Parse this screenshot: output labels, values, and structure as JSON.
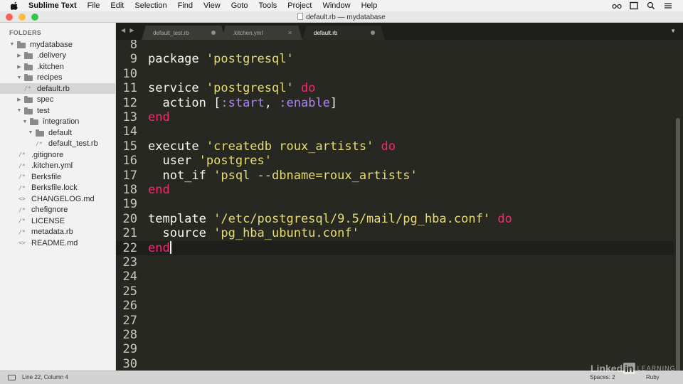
{
  "menubar": {
    "apple_icon": "apple-logo",
    "app_name": "Sublime Text",
    "items": [
      "File",
      "Edit",
      "Selection",
      "Find",
      "View",
      "Goto",
      "Tools",
      "Project",
      "Window",
      "Help"
    ],
    "right_icons": [
      "glasses-icon",
      "window-icon",
      "search-icon",
      "list-icon"
    ]
  },
  "window": {
    "title": "default.rb — mydatabase"
  },
  "sidebar": {
    "heading": "FOLDERS",
    "tree": [
      {
        "label": "mydatabase",
        "kind": "folder",
        "depth": 0,
        "expanded": true
      },
      {
        "label": ".delivery",
        "kind": "folder",
        "depth": 1,
        "expanded": false
      },
      {
        "label": ".kitchen",
        "kind": "folder",
        "depth": 1,
        "expanded": false
      },
      {
        "label": "recipes",
        "kind": "folder",
        "depth": 1,
        "expanded": true
      },
      {
        "label": "default.rb",
        "kind": "file",
        "glyph": "/*",
        "depth": 2,
        "selected": true
      },
      {
        "label": "spec",
        "kind": "folder",
        "depth": 1,
        "expanded": false
      },
      {
        "label": "test",
        "kind": "folder",
        "depth": 1,
        "expanded": true
      },
      {
        "label": "integration",
        "kind": "folder",
        "depth": 2,
        "expanded": true
      },
      {
        "label": "default",
        "kind": "folder",
        "depth": 3,
        "expanded": true
      },
      {
        "label": "default_test.rb",
        "kind": "file",
        "glyph": "/*",
        "depth": 4
      },
      {
        "label": ".gitignore",
        "kind": "file",
        "glyph": "/*",
        "depth": 1
      },
      {
        "label": ".kitchen.yml",
        "kind": "file",
        "glyph": "/*",
        "depth": 1
      },
      {
        "label": "Berksfile",
        "kind": "file",
        "glyph": "/*",
        "depth": 1
      },
      {
        "label": "Berksfile.lock",
        "kind": "file",
        "glyph": "/*",
        "depth": 1
      },
      {
        "label": "CHANGELOG.md",
        "kind": "file",
        "glyph": "<>",
        "depth": 1
      },
      {
        "label": "chefignore",
        "kind": "file",
        "glyph": "/*",
        "depth": 1
      },
      {
        "label": "LICENSE",
        "kind": "file",
        "glyph": "/*",
        "depth": 1
      },
      {
        "label": "metadata.rb",
        "kind": "file",
        "glyph": "/*",
        "depth": 1
      },
      {
        "label": "README.md",
        "kind": "file",
        "glyph": "<>",
        "depth": 1
      }
    ]
  },
  "tabs": [
    {
      "label": "default_test.rb",
      "state": "modified",
      "active": false
    },
    {
      "label": ".kitchen.yml",
      "state": "close",
      "active": false
    },
    {
      "label": "default.rb",
      "state": "modified",
      "active": true
    }
  ],
  "editor": {
    "current_line": 22,
    "lines": [
      {
        "n": "8",
        "tokens": []
      },
      {
        "n": "9",
        "tokens": [
          [
            "plain",
            "package "
          ],
          [
            "str",
            "'postgresql'"
          ]
        ]
      },
      {
        "n": "10",
        "tokens": []
      },
      {
        "n": "11",
        "tokens": [
          [
            "plain",
            "service "
          ],
          [
            "str",
            "'postgresql'"
          ],
          [
            "plain",
            " "
          ],
          [
            "kw",
            "do"
          ]
        ]
      },
      {
        "n": "12",
        "tokens": [
          [
            "plain",
            "  action ["
          ],
          [
            "sym",
            ":start"
          ],
          [
            "plain",
            ", "
          ],
          [
            "sym",
            ":enable"
          ],
          [
            "plain",
            "]"
          ]
        ]
      },
      {
        "n": "13",
        "tokens": [
          [
            "kw",
            "end"
          ]
        ]
      },
      {
        "n": "14",
        "tokens": []
      },
      {
        "n": "15",
        "tokens": [
          [
            "plain",
            "execute "
          ],
          [
            "str",
            "'createdb roux_artists'"
          ],
          [
            "plain",
            " "
          ],
          [
            "kw",
            "do"
          ]
        ]
      },
      {
        "n": "16",
        "tokens": [
          [
            "plain",
            "  user "
          ],
          [
            "str",
            "'postgres'"
          ]
        ]
      },
      {
        "n": "17",
        "tokens": [
          [
            "plain",
            "  not_if "
          ],
          [
            "str",
            "'psql --dbname=roux_artists'"
          ]
        ]
      },
      {
        "n": "18",
        "tokens": [
          [
            "kw",
            "end"
          ]
        ]
      },
      {
        "n": "19",
        "tokens": []
      },
      {
        "n": "20",
        "tokens": [
          [
            "plain",
            "template "
          ],
          [
            "str",
            "'/etc/postgresql/9.5/mail/pg_hba.conf'"
          ],
          [
            "plain",
            " "
          ],
          [
            "kw",
            "do"
          ]
        ]
      },
      {
        "n": "21",
        "tokens": [
          [
            "plain",
            "  source "
          ],
          [
            "str",
            "'pg_hba_ubuntu.conf'"
          ]
        ]
      },
      {
        "n": "22",
        "tokens": [
          [
            "kw",
            "end"
          ]
        ],
        "cursor": true
      },
      {
        "n": "23",
        "tokens": []
      },
      {
        "n": "24",
        "tokens": []
      },
      {
        "n": "25",
        "tokens": []
      },
      {
        "n": "26",
        "tokens": []
      },
      {
        "n": "27",
        "tokens": []
      },
      {
        "n": "28",
        "tokens": []
      },
      {
        "n": "29",
        "tokens": []
      },
      {
        "n": "30",
        "tokens": []
      }
    ]
  },
  "statusbar": {
    "position": "Line 22, Column 4",
    "spaces": "Spaces: 2",
    "syntax": "Ruby"
  },
  "watermark": {
    "brand_a": "Linked",
    "brand_b": "in",
    "brand_c": "LEARNING"
  },
  "colors": {
    "editor_bg": "#272822",
    "string": "#e6db74",
    "keyword": "#f92672",
    "symbol": "#ae81ff",
    "text": "#f8f8f2"
  }
}
